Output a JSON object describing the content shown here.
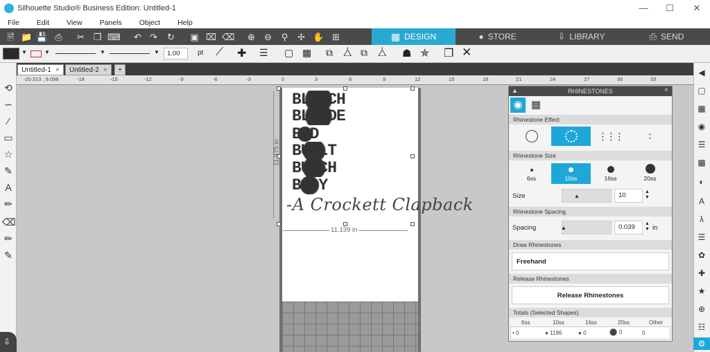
{
  "window": {
    "title": "Silhouette Studio® Business Edition: Untitled-1",
    "minimize": "—",
    "maximize": "☐",
    "close": "✕"
  },
  "menu": [
    "File",
    "Edit",
    "View",
    "Panels",
    "Object",
    "Help"
  ],
  "nav_tabs": [
    {
      "label": "DESIGN",
      "icon": "▦"
    },
    {
      "label": "STORE",
      "icon": "●"
    },
    {
      "label": "LIBRARY",
      "icon": "⇩"
    },
    {
      "label": "SEND",
      "icon": "⎙"
    }
  ],
  "colors": {
    "accent": "#1ea7d9",
    "design_tab": "#29a9cf",
    "dark_bar": "#4a4a4a"
  },
  "line_width": {
    "value": "1.00",
    "unit": "pt"
  },
  "doc_tabs": [
    "Untitled-1",
    "Untitled-2",
    "+"
  ],
  "ruler": {
    "h_labels": [
      "-20.313 , 9.098",
      "-18",
      "-15",
      "-12",
      "-9",
      "-6",
      "-3",
      "0",
      "3",
      "6",
      "9",
      "12",
      "15",
      "18",
      "21",
      "24",
      "27",
      "30",
      "33"
    ]
  },
  "design": {
    "words": [
      "BLEACH",
      "BLONDE",
      "BAD",
      "BUILT",
      "BUTCH",
      "BODY"
    ],
    "signature": "-A Crockett Clapback",
    "width_dim": "11.139 in",
    "height_dim": "11.375 in"
  },
  "panel": {
    "title": "RHINESTONES",
    "sections": {
      "effect": "Rhinestone Effect",
      "size": "Rhinestone Size",
      "spacing": "Rhinestone Spacing",
      "draw": "Draw Rhinestones",
      "release": "Release Rhinestones",
      "totals": "Totals (Selected Shapes)"
    },
    "sizes": [
      "6ss",
      "10ss",
      "16ss",
      "20ss"
    ],
    "size_label": "Size",
    "size_value": "10",
    "spacing_label": "Spacing",
    "spacing_value": "0.039",
    "spacing_unit": "in",
    "freehand": "Freehand",
    "release_button": "Release Rhinestones",
    "totals_headers": [
      "6ss",
      "10ss",
      "16ss",
      "20ss",
      "Other"
    ],
    "totals_values": [
      "0",
      "1196",
      "0",
      "0",
      "0"
    ]
  }
}
